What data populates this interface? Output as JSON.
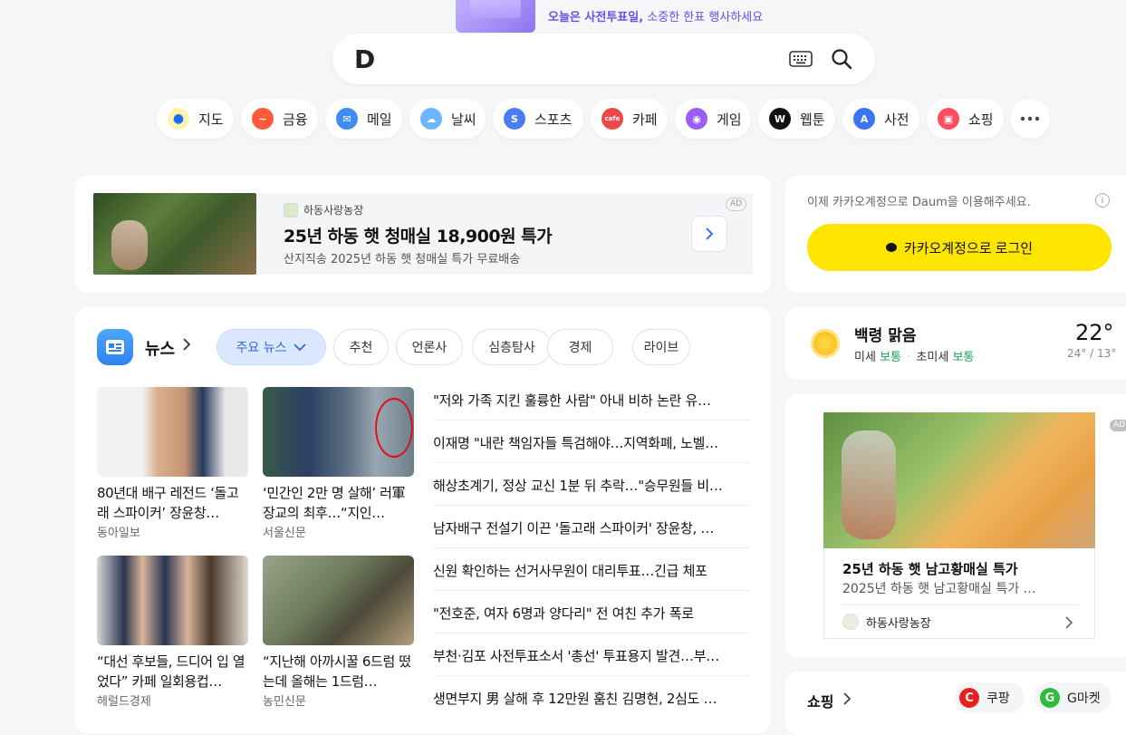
{
  "promo": {
    "highlight": "오늘은 사전투표일,",
    "rest": " 소중한 한표 행사하세요"
  },
  "search": {
    "logo": "D",
    "placeholder": ""
  },
  "shortcuts": [
    {
      "label": "지도",
      "icon": "map-pin-icon",
      "color": "#fff3b0"
    },
    {
      "label": "금융",
      "icon": "finance-chart-icon",
      "color": "#ff5a3c"
    },
    {
      "label": "메일",
      "icon": "mail-icon",
      "color": "#3d8cf5"
    },
    {
      "label": "날씨",
      "icon": "weather-cloud-icon",
      "color": "#6cb6ff"
    },
    {
      "label": "스포츠",
      "icon": "sports-icon",
      "color": "#4a7cf6"
    },
    {
      "label": "카페",
      "icon": "cafe-icon",
      "color": "#f04848"
    },
    {
      "label": "게임",
      "icon": "game-controller-icon",
      "color": "#9c5cf6"
    },
    {
      "label": "웹툰",
      "icon": "webtoon-icon",
      "color": "#111111"
    },
    {
      "label": "사전",
      "icon": "dictionary-icon",
      "color": "#3d74f5"
    },
    {
      "label": "쇼핑",
      "icon": "shopping-bag-icon",
      "color": "#ff4d5f"
    }
  ],
  "ad": {
    "brand": "하동사랑농장",
    "title": "25년 하동 햇 청매실 18,900원 특가",
    "desc": "산지직송 2025년 하동 햇 청매실 특가 무료배송",
    "badge": "AD"
  },
  "login": {
    "text": "이제 카카오계정으로 Daum을 이용해주세요.",
    "button": "카카오계정으로 로그인"
  },
  "news": {
    "title": "뉴스",
    "tabs": [
      "주요 뉴스",
      "추천",
      "언론사",
      "심층탐사",
      "경제",
      "라이브"
    ],
    "thumbs": [
      {
        "title": "80년대 배구 레전드 ‘돌고래 스파이커’ 장윤창…",
        "source": "동아일보"
      },
      {
        "title": "‘민간인 2만 명 살해’ 러軍 장교의 최후…“지인…",
        "source": "서울신문"
      },
      {
        "title": "“대선 후보들, 드디어 입 열었다” 카페 일회용컵…",
        "source": "헤럴드경제"
      },
      {
        "title": "“지난해 아까시꿀 6드럼 떴는데 올해는 1드럼…",
        "source": "농민신문"
      }
    ],
    "headlines": [
      "\"저와 가족 지킨 훌륭한 사람\" 아내 비하 논란 유…",
      "이재명 \"내란 책임자들 특검해야…지역화폐, 노벨…",
      "해상초계기, 정상 교신 1분 뒤 추락…\"승무원들 비…",
      "남자배구 전설기 이끈 '돌고래 스파이커' 장윤창, …",
      "신원 확인하는 선거사무원이 대리투표…긴급 체포",
      "\"전호준, 여자 6명과 양다리\" 전 여친 추가 폭로",
      "부천·김포 사전투표소서 '총선' 투표용지 발견…부…",
      "생면부지 男 살해 후 12만원 훔친 김명현, 2심도 …"
    ]
  },
  "weather": {
    "location": "백령 맑음",
    "dust_label": "미세",
    "dust_value": "보통",
    "ultra_label": "초미세",
    "ultra_value": "보통",
    "temp": "22°",
    "range": "24° / 13°"
  },
  "ad2": {
    "badge": "AD",
    "title": "25년 하동 햇 남고황매실 특가",
    "desc": "2025년 하동 햇 남고황매실 특가 …",
    "brand": "하동사랑농장"
  },
  "shopping": {
    "title": "쇼핑",
    "stores": [
      {
        "label": "쿠팡",
        "glyph": "C",
        "color": "#e8201e"
      },
      {
        "label": "G마켓",
        "glyph": "G",
        "color": "#2ebc3a"
      }
    ]
  }
}
